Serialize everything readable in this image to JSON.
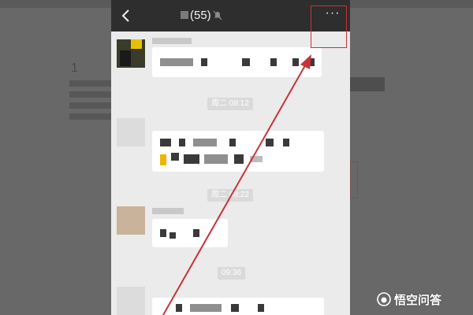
{
  "chat": {
    "title": "(55)",
    "more_label": "···",
    "timestamps": [
      "周二 08:12",
      "周二 08:22",
      "09:36"
    ]
  },
  "watermark": {
    "text": "悟空问答",
    "logo": "wukong-logo"
  },
  "background": {
    "step_number": "1"
  },
  "colors": {
    "annotation_red": "#c8333a",
    "header_bg": "#2e2e2e",
    "chat_bg": "#ebebeb"
  },
  "icons": [
    "chevron-left-icon",
    "mute-bell-icon",
    "more-icon"
  ]
}
